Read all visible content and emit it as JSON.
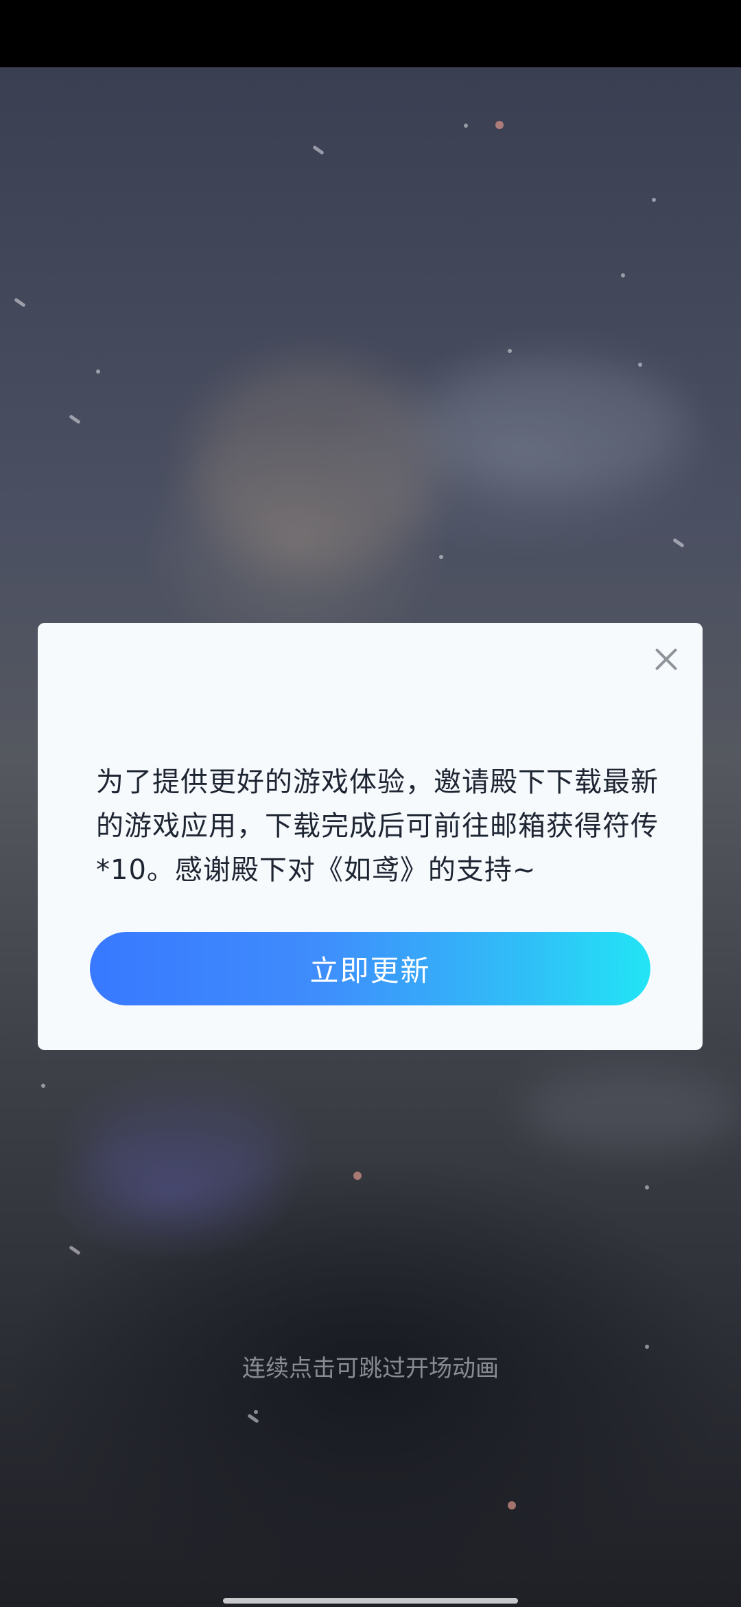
{
  "dialog": {
    "close_icon": "close-icon",
    "message": "为了提供更好的游戏体验，邀请殿下下载最新的游戏应用，下载完成后可前往邮箱获得符传*10。感谢殿下对《如鸢》的支持~",
    "update_button_label": "立即更新"
  },
  "background": {
    "skip_hint": "连续点击可跳过开场动画"
  },
  "colors": {
    "button_gradient_start": "#3879ff",
    "button_gradient_end": "#22e5f5",
    "dialog_background": "#f7fafd",
    "message_text": "#1e2532"
  }
}
